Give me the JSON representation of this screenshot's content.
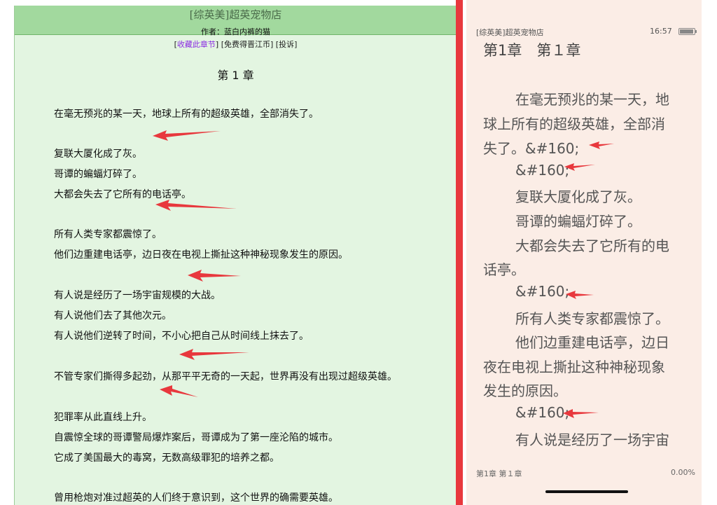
{
  "left": {
    "book_title": "[综英美]超英宠物店",
    "author_line": "作者：蓝白内裤的猫",
    "links": {
      "open": "[",
      "favorite": "收藏此章节",
      "mid": "] [免费得晋江币] [投诉]"
    },
    "chapter_heading": "第 1 章",
    "paragraphs": [
      "在毫无预兆的某一天，地球上所有的超级英雄，全部消失了。",
      "复联大厦化成了灰。",
      "哥谭的蝙蝠灯碎了。",
      "大都会失去了它所有的电话亭。",
      "所有人类专家都震惊了。",
      "他们边重建电话亭，边日夜在电视上撕扯这种神秘现象发生的原因。",
      "有人说是经历了一场宇宙规模的大战。",
      "有人说他们去了其他次元。",
      "有人说他们逆转了时间，不小心把自己从时间线上抹去了。",
      "不管专家们撕得多起劲，从那平平无奇的一天起，世界再没有出现过超级英雄。",
      "犯罪率从此直线上升。",
      "自震惊全球的哥谭警局爆炸案后，哥谭成为了第一座沦陷的城市。",
      "它成了美国最大的毒窝，无数高级罪犯的培养之都。",
      "曾用枪炮对准过超英的人们终于意识到，这个世界的确需要英雄。"
    ]
  },
  "right": {
    "status_title": "[综英美]超英宠物店",
    "status_time": "16:57",
    "chapter_title": "第1章　第１章",
    "lines": [
      "在毫无预兆的某一天，地",
      "球上所有的超级英雄，全部消",
      "失了。&#160;",
      "&#160;",
      "复联大厦化成了灰。",
      "哥谭的蝙蝠灯碎了。",
      "大都会失去了它所有的电",
      "话亭。",
      "&#160;",
      "所有人类专家都震惊了。",
      "他们边重建电话亭，边日",
      "夜在电视上撕扯这种神秘现象",
      "发生的原因。",
      "&#160;",
      "有人说是经历了一场宇宙"
    ],
    "footer_chapter": "第1章 第１章",
    "footer_progress": "0.00%"
  },
  "colors": {
    "arrow": "#e8383d",
    "left_bg": "#e3f5e1",
    "header_bg": "#a2d99e",
    "right_bg": "#fbede6",
    "divider": "#e8383d"
  }
}
